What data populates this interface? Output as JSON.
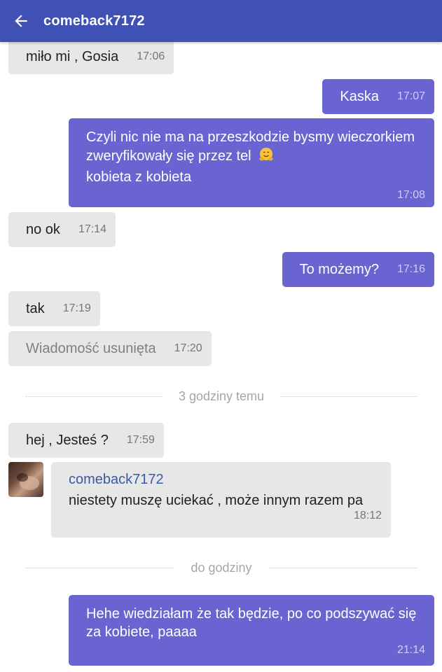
{
  "header": {
    "title": "comeback7172"
  },
  "messages": {
    "m1": {
      "text": "miło mi , Gosia",
      "time": "17:06"
    },
    "m2": {
      "text": "Kaska",
      "time": "17:07"
    },
    "m3": {
      "text": "Czyli nic nie ma na przeszkodzie bysmy wieczorkiem zweryfikowały się przez tel",
      "emoji": "hugging-face",
      "text2": "kobieta z kobieta",
      "time": "17:08"
    },
    "m4": {
      "text": "no ok",
      "time": "17:14"
    },
    "m5": {
      "text": "To możemy?",
      "time": "17:16"
    },
    "m6": {
      "text": "tak",
      "time": "17:19"
    },
    "m7": {
      "text": "Wiadomość usunięta",
      "time": "17:20"
    },
    "m8": {
      "text": "hej , Jesteś ?",
      "time": "17:59"
    },
    "m9": {
      "sender": "comeback7172",
      "text": "niestety muszę uciekać , może innym razem pa",
      "time": "18:12"
    },
    "m10": {
      "text": "Hehe wiedziałam że tak będzie, po co podszywać się za kobiete, paaaa",
      "time": "21:14"
    }
  },
  "separators": {
    "s1": "3 godziny temu",
    "s2": "do godziny"
  },
  "colors": {
    "header": "#3f51b5",
    "outgoing_bubble": "#6a63d2",
    "incoming_bubble": "#e7e7e7",
    "sender_name": "#3b5aa3"
  },
  "icons": {
    "back": "arrow-left-icon",
    "emoji": "hugging-face-emoji"
  }
}
